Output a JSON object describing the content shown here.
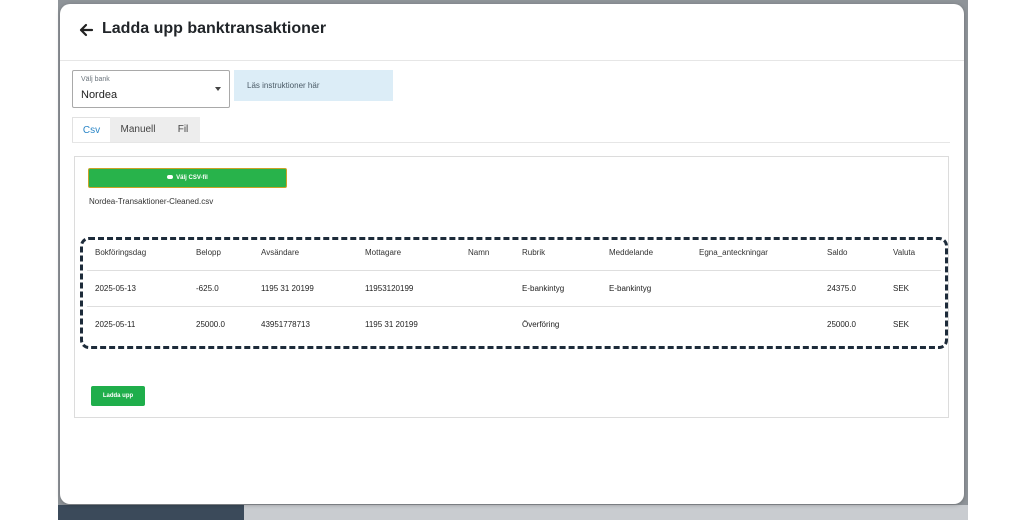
{
  "header": {
    "title": "Ladda upp banktransaktioner"
  },
  "bank_select": {
    "label": "Välj bank",
    "value": "Nordea"
  },
  "instructions": {
    "text": "Läs instruktioner här"
  },
  "tabs": [
    {
      "label": "Csv",
      "active": true
    },
    {
      "label": "Manuell",
      "active": false
    },
    {
      "label": "Fil",
      "active": false
    }
  ],
  "csv": {
    "choose_button_label": "Välj CSV-fil",
    "filename": "Nordea-Transaktioner-Cleaned.csv"
  },
  "table": {
    "columns": [
      "Bokföringsdag",
      "Belopp",
      "Avsändare",
      "Mottagare",
      "Namn",
      "Rubrik",
      "Meddelande",
      "Egna_anteckningar",
      "Saldo",
      "Valuta"
    ],
    "rows": [
      [
        "2025-05-13",
        "-625.0",
        "1195 31 20199",
        "11953120199",
        "",
        "E-bankintyg",
        "E-bankintyg",
        "",
        "24375.0",
        "SEK"
      ],
      [
        "2025-05-11",
        "25000.0",
        "43951778713",
        "1195 31 20199",
        "",
        "Överföring",
        "",
        "",
        "25000.0",
        "SEK"
      ]
    ]
  },
  "upload_button": {
    "label": "Ladda upp"
  },
  "colors": {
    "primary_green": "#28b34b",
    "info_bg": "#dcedf7",
    "tab_active": "#2a86c7",
    "highlight_border": "#1d2b3a"
  }
}
